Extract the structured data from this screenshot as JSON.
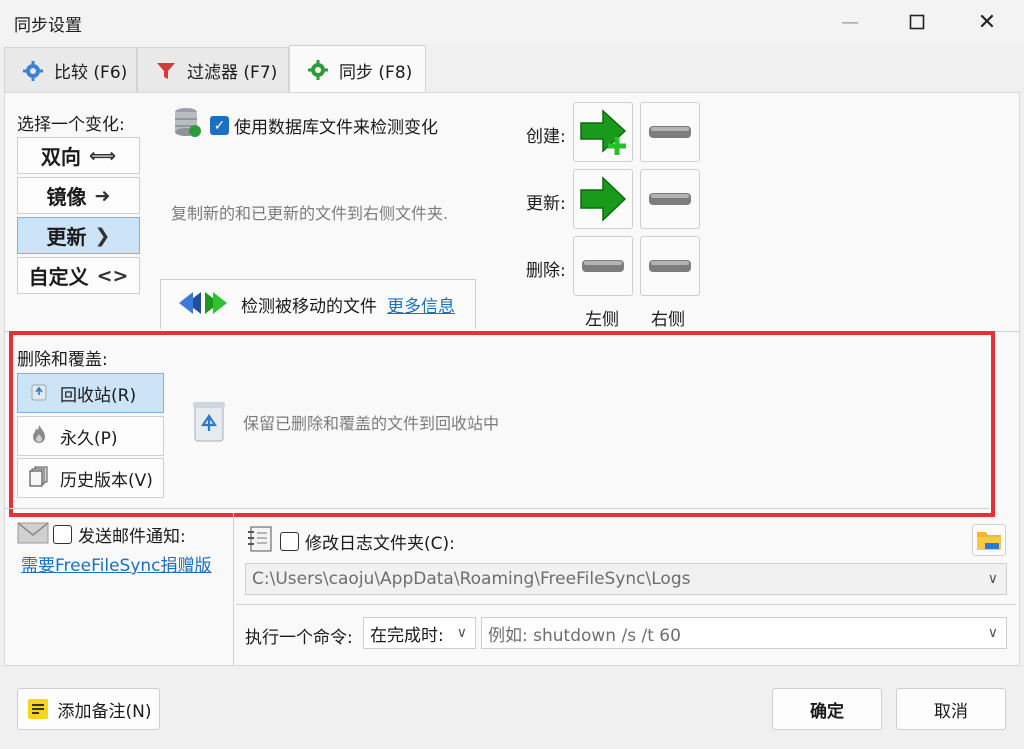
{
  "window": {
    "title": "同步设置"
  },
  "tabs": [
    {
      "label": "比较 (F6)"
    },
    {
      "label": "过滤器 (F7)"
    },
    {
      "label": "同步 (F8)"
    }
  ],
  "variant": {
    "heading": "选择一个变化:",
    "options": [
      {
        "label": "双向",
        "arrow": "⟺"
      },
      {
        "label": "镜像",
        "arrow": "➜"
      },
      {
        "label": "更新",
        "arrow": "❯"
      },
      {
        "label": "自定义",
        "arrow": "<>"
      }
    ],
    "selected": "更新"
  },
  "database": {
    "checkbox_label": "使用数据库文件来检测变化",
    "checked": true
  },
  "description": "复制新的和已更新的文件到右侧文件夹.",
  "actions": {
    "rows": [
      {
        "label": "创建:"
      },
      {
        "label": "更新:"
      },
      {
        "label": "删除:"
      }
    ],
    "left_label": "左侧",
    "right_label": "右侧"
  },
  "moved_files": {
    "label": "检测被移动的文件",
    "link": "更多信息"
  },
  "deletion": {
    "heading": "删除和覆盖:",
    "options": [
      {
        "label": "回收站(R)"
      },
      {
        "label": "永久(P)"
      },
      {
        "label": "历史版本(V)"
      }
    ],
    "selected": "回收站(R)",
    "description": "保留已删除和覆盖的文件到回收站中"
  },
  "email": {
    "checkbox_label": "发送邮件通知:",
    "checked": false,
    "donation_link": "需要FreeFileSync捐赠版"
  },
  "log": {
    "checkbox_label": "修改日志文件夹(C):",
    "checked": false,
    "path": "C:\\Users\\caoju\\AppData\\Roaming\\FreeFileSync\\Logs"
  },
  "command": {
    "label": "执行一个命令:",
    "when_value": "在完成时:",
    "placeholder": "例如: shutdown /s /t 60"
  },
  "footer": {
    "add_note": "添加备注(N)",
    "ok": "确定",
    "cancel": "取消"
  },
  "colors": {
    "accent": "#1d6fc2",
    "selection": "#cde4f7",
    "highlight_frame": "#e63232",
    "arrow_green": "#1a9a1a"
  }
}
